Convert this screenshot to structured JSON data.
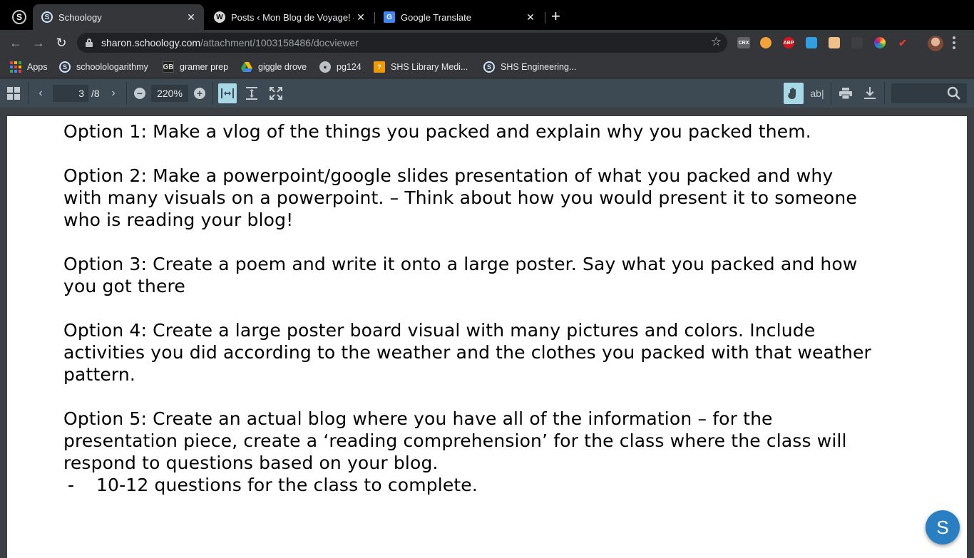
{
  "browser": {
    "tabs": [
      {
        "title": "Schoology",
        "favicon": "schoology-icon",
        "active": true
      },
      {
        "title": "Posts ‹ Mon Blog de Voyage! —",
        "favicon": "wordpress-icon",
        "active": false
      },
      {
        "title": "Google Translate",
        "favicon": "google-translate-icon",
        "active": false
      }
    ],
    "url": {
      "host": "sharon.schoology.com",
      "path": "/attachment/1003158486/docviewer"
    },
    "extensions": [
      {
        "label": "CRX",
        "color": "#5f6368"
      },
      {
        "label": "",
        "color": "#f2a33a"
      },
      {
        "label": "ABP",
        "color": "#d3161b"
      },
      {
        "label": "",
        "color": "#2f9fe0"
      },
      {
        "label": "",
        "color": "#f0c08a"
      },
      {
        "label": "",
        "color": "#3c3f43"
      },
      {
        "label": "",
        "color": "#9b59d0"
      },
      {
        "label": "",
        "color": "#c62828"
      }
    ]
  },
  "bookmarks": [
    {
      "label": "Apps",
      "icon": "apps-grid-icon"
    },
    {
      "label": "schoolologarithmy",
      "icon": "schoology-icon"
    },
    {
      "label": "gramer prep",
      "icon": "gb-icon"
    },
    {
      "label": "giggle drove",
      "icon": "google-drive-icon"
    },
    {
      "label": "pg124",
      "icon": "globe-icon"
    },
    {
      "label": "SHS Library Medi...",
      "icon": "library-icon"
    },
    {
      "label": "SHS Engineering...",
      "icon": "schoology-icon"
    }
  ],
  "viewer": {
    "current_page": "3",
    "total_pages": "/8",
    "zoom": "220%"
  },
  "document": {
    "options": [
      "Option 1: Make a vlog of the things you packed and explain why you packed them.",
      "Option 2: Make a powerpoint/google slides presentation of what you packed and why\nwith many visuals on a powerpoint. – Think about how you would present it to someone\nwho is reading your blog!",
      "Option 3: Create a poem and write it onto a large poster. Say what you packed and how\nyou got there",
      "Option 4: Create a large poster board visual with many pictures and colors. Include\nactivities you did according to the weather and the clothes you packed with that weather\npattern.",
      "Option 5: Create an actual blog where you have all of the information – for the\npresentation piece, create a ‘reading comprehension’ for the class where the class will\nrespond to questions based on your blog."
    ],
    "bullet_dash": "-",
    "bullet": "10-12 questions for the class to complete."
  },
  "fab_label": "S"
}
